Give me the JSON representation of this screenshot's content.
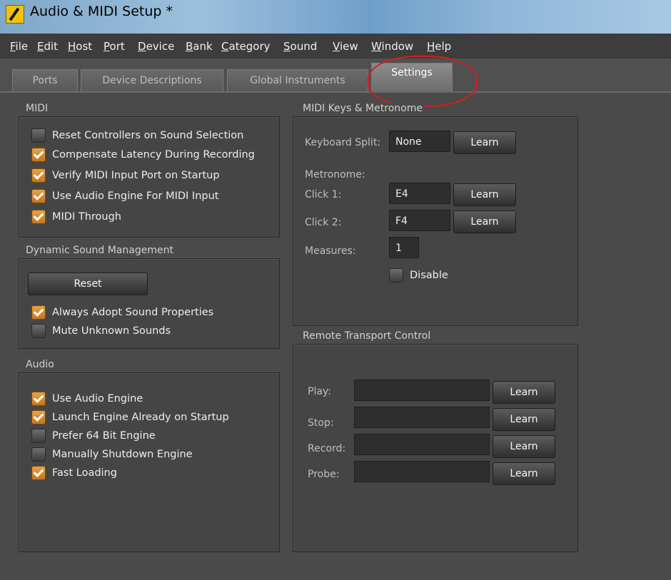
{
  "window": {
    "title": "Audio & MIDI Setup *"
  },
  "menu": [
    "File",
    "Edit",
    "Host",
    "Port",
    "Device",
    "Bank",
    "Category",
    "Sound",
    "View",
    "Window",
    "Help"
  ],
  "tabs": [
    {
      "label": "Ports"
    },
    {
      "label": "Device Descriptions"
    },
    {
      "label": "Global Instruments"
    },
    {
      "label": "Settings",
      "active": true
    }
  ],
  "midi": {
    "title": "MIDI",
    "options": [
      {
        "label": "Reset Controllers on Sound Selection",
        "checked": false
      },
      {
        "label": "Compensate Latency During Recording",
        "checked": true
      },
      {
        "label": "Verify MIDI Input Port on Startup",
        "checked": true
      },
      {
        "label": "Use Audio Engine For MIDI Input",
        "checked": true
      },
      {
        "label": "MIDI Through",
        "checked": true
      }
    ]
  },
  "dsm": {
    "title": "Dynamic Sound Management",
    "reset_label": "Reset",
    "options": [
      {
        "label": "Always Adopt Sound Properties",
        "checked": true
      },
      {
        "label": "Mute Unknown Sounds",
        "checked": false
      }
    ]
  },
  "audio": {
    "title": "Audio",
    "options": [
      {
        "label": "Use Audio Engine",
        "checked": true
      },
      {
        "label": "Launch Engine Already on Startup",
        "checked": true
      },
      {
        "label": "Prefer 64 Bit Engine",
        "checked": false
      },
      {
        "label": "Manually Shutdown Engine",
        "checked": false
      },
      {
        "label": "Fast Loading",
        "checked": true
      }
    ]
  },
  "keys": {
    "title": "MIDI Keys & Metronome",
    "keyboard_split_label": "Keyboard Split:",
    "keyboard_split_value": "None",
    "metronome_label": "Metronome:",
    "click1_label": "Click 1:",
    "click1_value": "E4",
    "click2_label": "Click 2:",
    "click2_value": "F4",
    "measures_label": "Measures:",
    "measures_value": "1",
    "disable_label": "Disable",
    "disable_checked": false,
    "learn_label": "Learn"
  },
  "remote": {
    "title": "Remote Transport Control",
    "rows": [
      {
        "label": "Play:",
        "value": ""
      },
      {
        "label": "Stop:",
        "value": ""
      },
      {
        "label": "Record:",
        "value": ""
      },
      {
        "label": "Probe:",
        "value": ""
      }
    ],
    "learn_label": "Learn"
  },
  "colors": {
    "background": "#4a4a4a",
    "panel": "#454545",
    "checkbox_checked": "#d9892e",
    "annotation": "#d41e1e"
  }
}
